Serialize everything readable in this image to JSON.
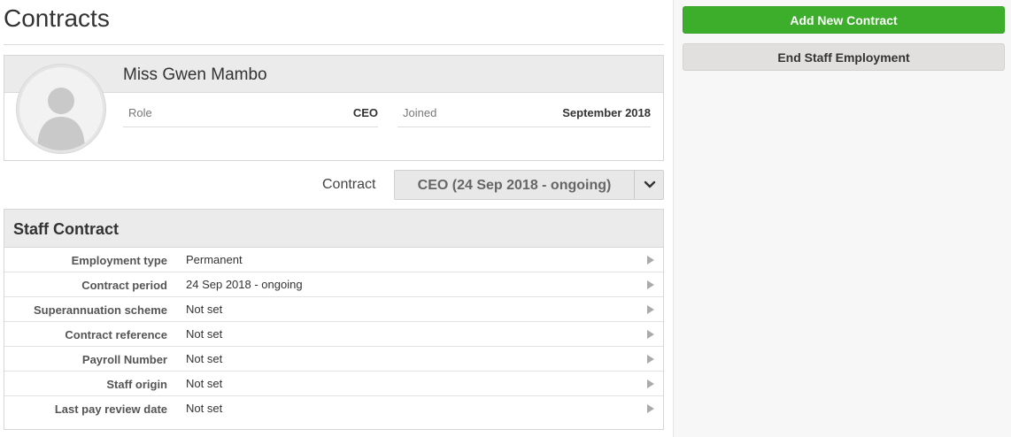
{
  "page": {
    "title": "Contracts"
  },
  "profile": {
    "name": "Miss Gwen Mambo",
    "role_label": "Role",
    "role_value": "CEO",
    "joined_label": "Joined",
    "joined_value": "September 2018"
  },
  "contract_selector": {
    "label": "Contract",
    "selected": "CEO (24 Sep 2018 - ongoing)",
    "icon": "chevron-down-icon"
  },
  "staff_contract": {
    "title": "Staff Contract",
    "rows": [
      {
        "label": "Employment type",
        "value": "Permanent"
      },
      {
        "label": "Contract period",
        "value": "24 Sep 2018 - ongoing"
      },
      {
        "label": "Superannuation scheme",
        "value": "Not set"
      },
      {
        "label": "Contract reference",
        "value": "Not set"
      },
      {
        "label": "Payroll Number",
        "value": "Not set"
      },
      {
        "label": "Staff origin",
        "value": "Not set"
      },
      {
        "label": "Last pay review date",
        "value": "Not set"
      }
    ]
  },
  "actions": {
    "add_contract": "Add New Contract",
    "end_employment": "End Staff Employment"
  },
  "colors": {
    "primary_green": "#3dae2b",
    "secondary_button": "#e2e0df",
    "panel_header": "#ebebeb"
  }
}
